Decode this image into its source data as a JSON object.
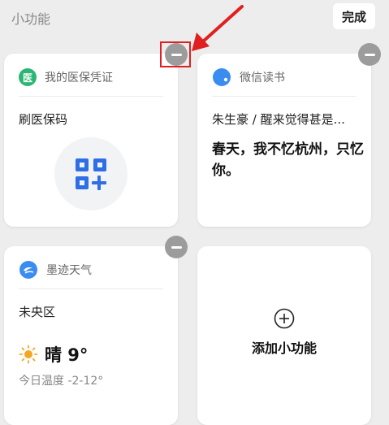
{
  "header": {
    "title": "小功能",
    "done_label": "完成"
  },
  "cards": {
    "medical": {
      "app_name": "我的医保凭证",
      "icon_char": "医",
      "icon_color": "#2bb673",
      "action_label": "刷医保码",
      "qr_icon_color": "#2f6fe6"
    },
    "weread": {
      "app_name": "微信读书",
      "icon_color": "#3a8cf0",
      "book_line": "朱生豪 / 醒来觉得甚是...",
      "quote": "春天，我不忆杭州，只忆你。"
    },
    "weather": {
      "app_name": "墨迹天气",
      "icon_color": "#3a8cf0",
      "district": "未央区",
      "condition": "晴 9°",
      "temp_range": "今日温度 -2-12°",
      "sun_color": "#f5a623"
    },
    "add": {
      "label": "添加小功能",
      "icon": "plus-circle-icon"
    }
  },
  "colors": {
    "remove_button": "#9c9c9c",
    "annotation": "#e02020"
  }
}
